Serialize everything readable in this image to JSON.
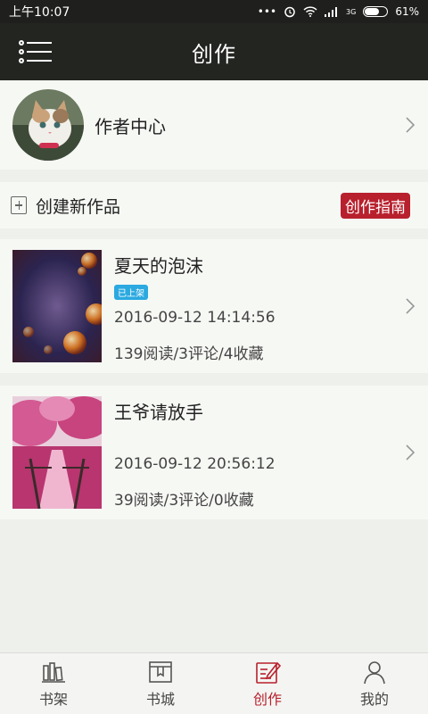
{
  "status_bar": {
    "time": "上午10:07",
    "dots": "•••",
    "network": "3G",
    "battery": "61%",
    "battery_level": 0.61
  },
  "header": {
    "title": "创作",
    "menu_icon": "list-menu-icon"
  },
  "author_center": {
    "label": "作者中心",
    "avatar_icon": "cat-avatar"
  },
  "create_row": {
    "label": "创建新作品",
    "guide_button": "创作指南"
  },
  "works": [
    {
      "title": "夏天的泡沫",
      "badge": "已上架",
      "date": "2016-09-12 14:14:56",
      "stats": "139阅读/3评论/4收藏",
      "cover": "bubbles-cover"
    },
    {
      "title": "王爷请放手",
      "badge": "",
      "date": "2016-09-12 20:56:12",
      "stats": "39阅读/3评论/0收藏",
      "cover": "pink-trees-cover"
    }
  ],
  "tabs": [
    {
      "label": "书架",
      "icon": "bookshelf-icon"
    },
    {
      "label": "书城",
      "icon": "bookstore-icon"
    },
    {
      "label": "创作",
      "icon": "write-icon",
      "active": true
    },
    {
      "label": "我的",
      "icon": "profile-icon"
    }
  ],
  "colors": {
    "accent": "#b8202d",
    "badge": "#2ba9e0",
    "header": "#232521"
  }
}
